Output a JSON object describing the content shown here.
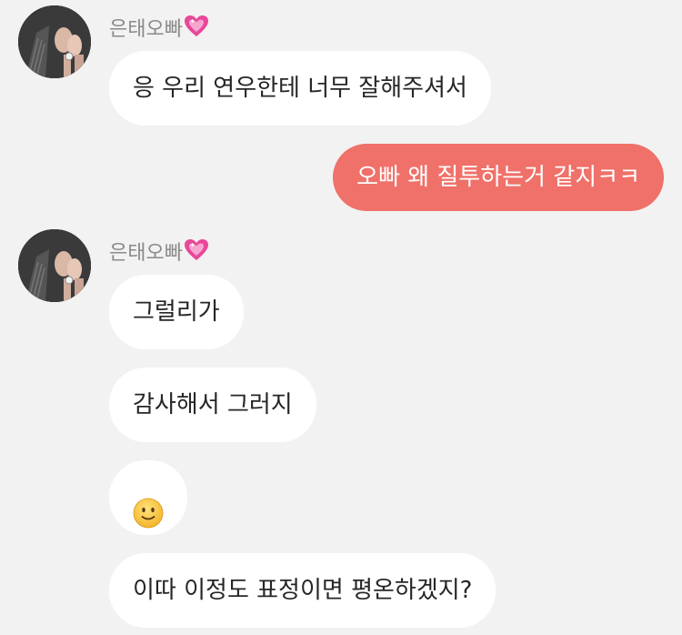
{
  "conversation": {
    "sender": {
      "name": "은태오빠",
      "name_suffix_icon": "pink-sparkling-heart-icon"
    },
    "messages": [
      {
        "text": "응 우리 연우한테 너무 잘해주셔서",
        "direction": "incoming"
      },
      {
        "text": "오빠 왜 질투하는거 같지ㅋㅋ",
        "direction": "outgoing"
      },
      {
        "text": "그럴리가",
        "direction": "incoming"
      },
      {
        "text": "감사해서 그러지",
        "direction": "incoming"
      },
      {
        "text": "",
        "emoji": "slightly-smiling-face-icon",
        "direction": "incoming"
      },
      {
        "text": "이따 이정도 표정이면 평온하겠지?",
        "direction": "incoming"
      }
    ]
  },
  "colors": {
    "background": "#f2f2f2",
    "incoming_bubble": "#ffffff",
    "outgoing_bubble": "#ef7169",
    "sender_name": "#8a8a8a",
    "heart": "#e8479a"
  }
}
